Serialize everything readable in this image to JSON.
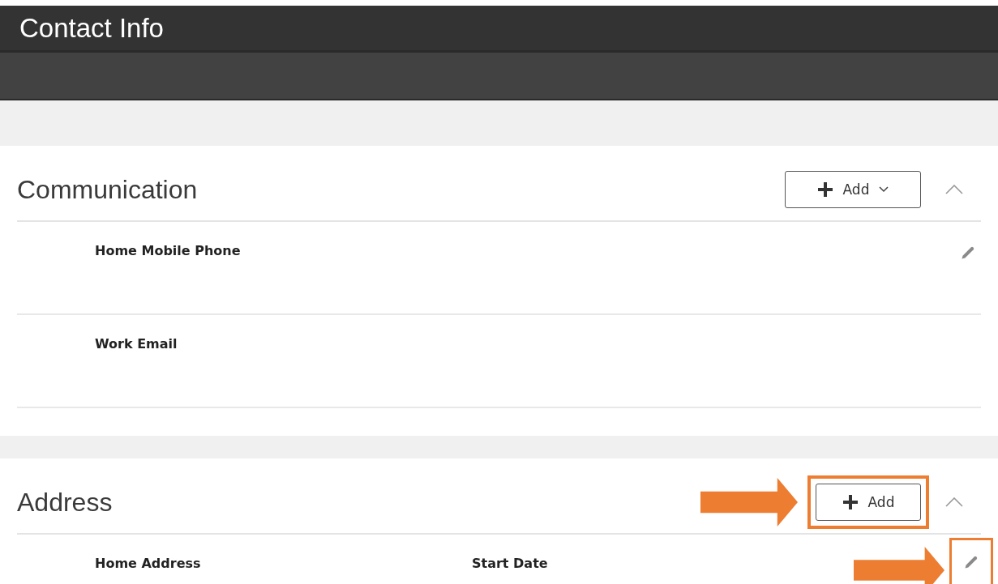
{
  "page": {
    "title": "Contact Info"
  },
  "sections": [
    {
      "title": "Communication",
      "expanded": true,
      "add_button": {
        "label": "Add",
        "has_menu": true,
        "highlighted": false
      },
      "rows": [
        {
          "label": "Home Mobile Phone",
          "editable": true,
          "edit_highlighted": false
        },
        {
          "label": "Work Email",
          "editable": false
        }
      ]
    },
    {
      "title": "Address",
      "expanded": true,
      "add_button": {
        "label": "Add",
        "has_menu": false,
        "highlighted": true
      },
      "rows": [
        {
          "label": "Home Address",
          "detail_label": "Start Date",
          "editable": true,
          "edit_highlighted": true
        }
      ]
    }
  ]
}
